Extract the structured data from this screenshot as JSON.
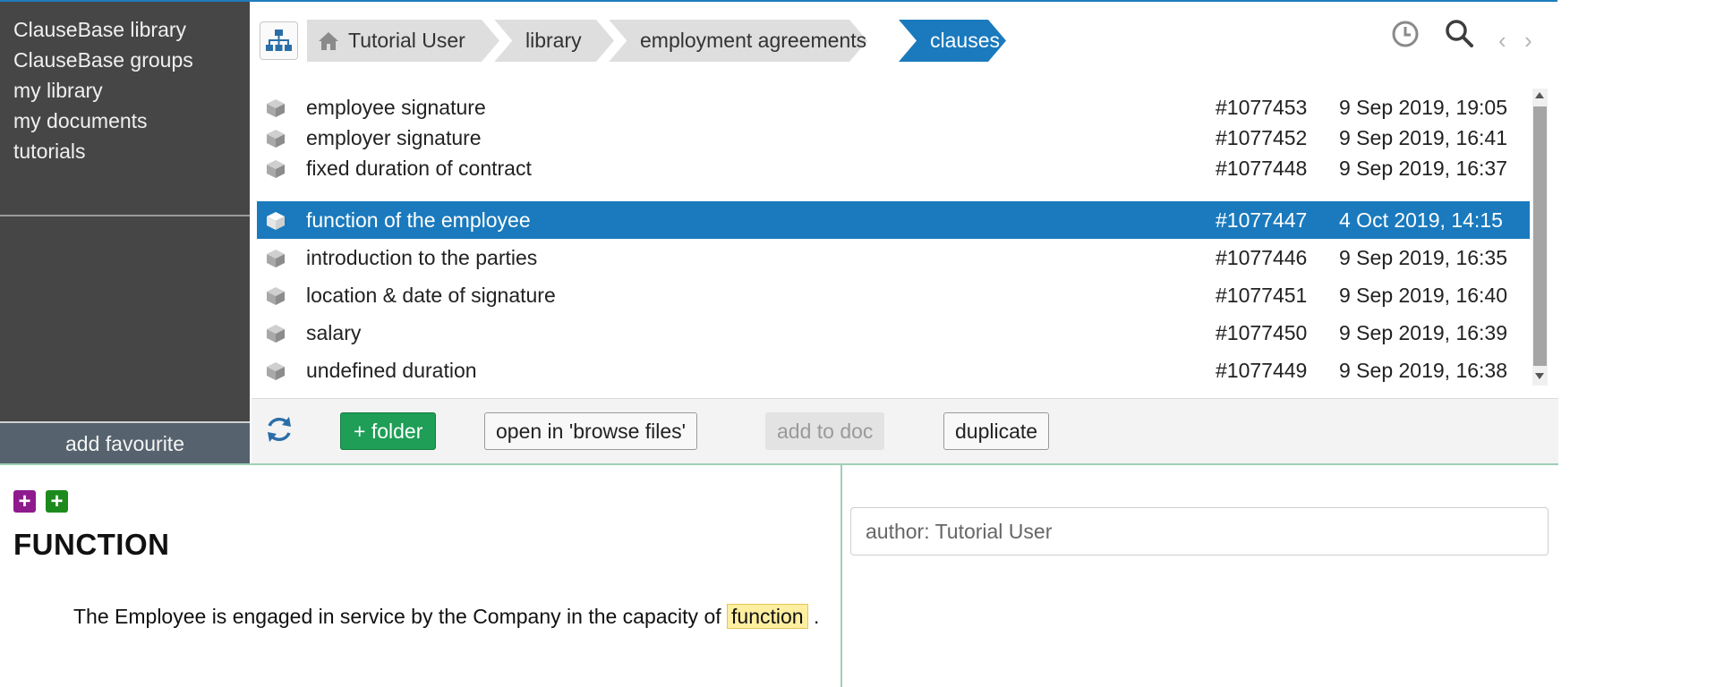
{
  "sidebar": {
    "items": [
      {
        "label": "ClauseBase library"
      },
      {
        "label": "ClauseBase groups"
      },
      {
        "label": "my library"
      },
      {
        "label": "my documents"
      },
      {
        "label": "tutorials"
      }
    ],
    "favourite_label": "add favourite"
  },
  "breadcrumb": [
    "Tutorial User",
    "library",
    "employment agreements",
    "clauses"
  ],
  "files": [
    {
      "name": "employee signature",
      "id": "#1077453",
      "date": "9 Sep 2019, 19:05",
      "selected": false
    },
    {
      "name": "employer signature",
      "id": "#1077452",
      "date": "9 Sep 2019, 16:41",
      "selected": false
    },
    {
      "name": "fixed duration of contract",
      "id": "#1077448",
      "date": "9 Sep 2019, 16:37",
      "selected": false
    },
    {
      "name": "function of the employee",
      "id": "#1077447",
      "date": "4 Oct 2019, 14:15",
      "selected": true
    },
    {
      "name": "introduction to the parties",
      "id": "#1077446",
      "date": "9 Sep 2019, 16:35",
      "selected": false
    },
    {
      "name": "location & date of signature",
      "id": "#1077451",
      "date": "9 Sep 2019, 16:40",
      "selected": false
    },
    {
      "name": "salary",
      "id": "#1077450",
      "date": "9 Sep 2019, 16:39",
      "selected": false
    },
    {
      "name": "undefined duration",
      "id": "#1077449",
      "date": "9 Sep 2019, 16:38",
      "selected": false
    }
  ],
  "toolbar": {
    "folder_label": "+ folder",
    "open_label": "open in 'browse files'",
    "add_label": "add to doc",
    "duplicate_label": "duplicate"
  },
  "document": {
    "title": "FUNCTION",
    "body_prefix": "The Employee is engaged in service by the Company in the capacity of",
    "placeholder": "function",
    "body_suffix": "."
  },
  "author_field": {
    "value": "author: Tutorial User"
  },
  "icons": {
    "tree": "sitemap-icon",
    "home": "home-icon",
    "history": "clock-icon",
    "search": "search-icon",
    "back": "chevron-left-icon",
    "forward": "chevron-right-icon",
    "refresh": "refresh-icon",
    "file": "cube-icon",
    "add_purple": "plus-square-icon",
    "add_green": "plus-square-icon"
  },
  "colors": {
    "accent": "#1a7abd",
    "sidebar_bg": "#464646",
    "favourite_bg": "#56636e",
    "folder_btn": "#1e9e56",
    "placeholder_highlight": "#fdeea0",
    "purple_add": "#8e1a8e",
    "green_add": "#1d8a1d"
  }
}
